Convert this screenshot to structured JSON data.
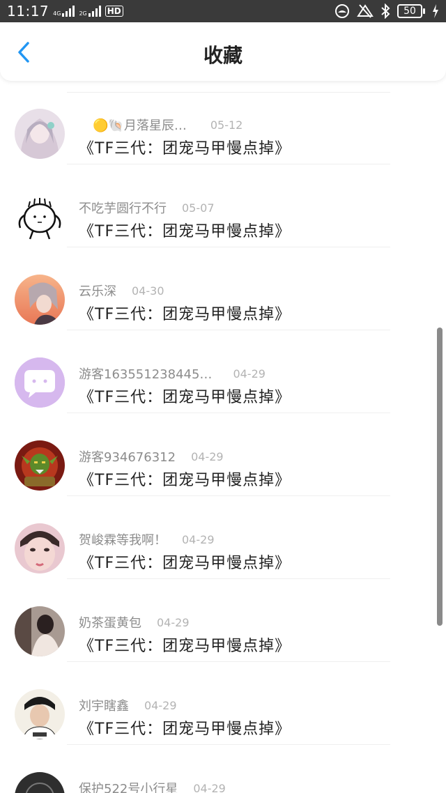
{
  "status_bar": {
    "time": "11:17",
    "net1": "4G",
    "net2": "2G",
    "hd": "HD",
    "battery": "50"
  },
  "header": {
    "title": "收藏"
  },
  "items": [
    {
      "name": "🟡🐚月落星辰…",
      "date": "05-12",
      "title": "《TF三代：团宠马甲慢点掉》"
    },
    {
      "name": "不吃芋圆行不行",
      "date": "05-07",
      "title": "《TF三代：团宠马甲慢点掉》"
    },
    {
      "name": "云乐深",
      "date": "04-30",
      "title": "《TF三代：团宠马甲慢点掉》"
    },
    {
      "name": "游客163551238445…",
      "date": "04-29",
      "title": "《TF三代：团宠马甲慢点掉》"
    },
    {
      "name": "游客934676312",
      "date": "04-29",
      "title": "《TF三代：团宠马甲慢点掉》"
    },
    {
      "name": "贺峻霖等我啊！",
      "date": "04-29",
      "title": "《TF三代：团宠马甲慢点掉》"
    },
    {
      "name": "奶茶蛋黄包",
      "date": "04-29",
      "title": "《TF三代：团宠马甲慢点掉》"
    },
    {
      "name": "刘宇瞎鑫",
      "date": "04-29",
      "title": "《TF三代：团宠马甲慢点掉》"
    },
    {
      "name": "保护522号小行星",
      "date": "04-29",
      "title": ""
    }
  ],
  "colors": {
    "accent_blue": "#2196f3",
    "status_bar_bg": "#3a3a3a",
    "chat_avatar_bg": "#d6b8ee"
  }
}
